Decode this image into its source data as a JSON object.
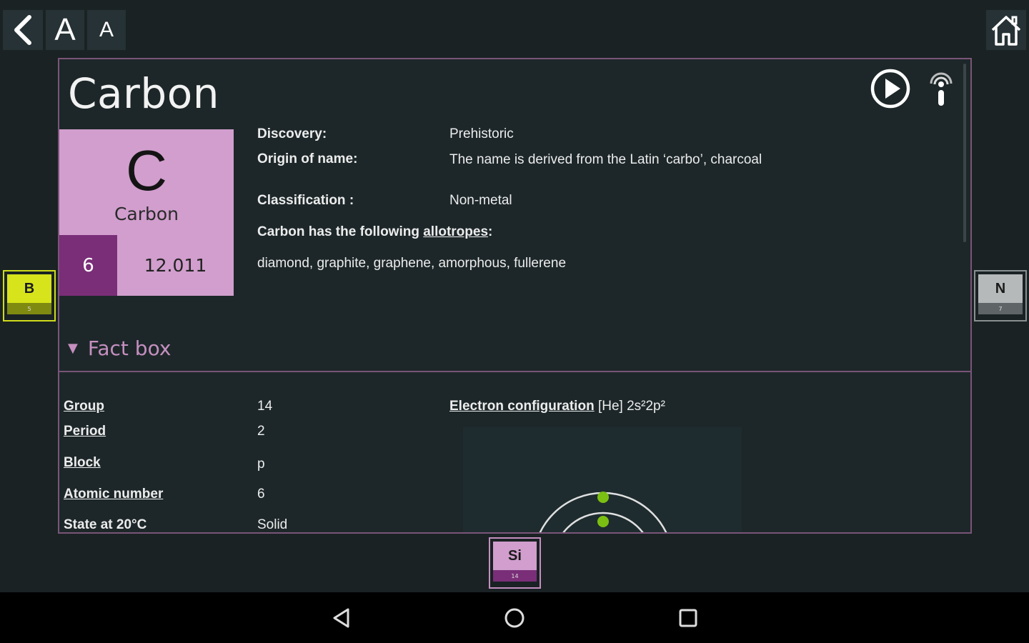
{
  "toolbar": {
    "font_larger_label": "A",
    "font_smaller_label": "A",
    "back_icon": "chevron-left-icon",
    "home_icon": "home-icon"
  },
  "element": {
    "name": "Carbon",
    "symbol": "C",
    "tile_name": "Carbon",
    "atomic_number": "6",
    "atomic_mass": "12.011",
    "color": "#d19ecd",
    "number_color": "#7a2e78"
  },
  "info": {
    "discovery_label": "Discovery:",
    "discovery_value": "Prehistoric",
    "origin_label": "Origin of name:",
    "origin_value": "The name is derived from the Latin ‘carbo’, charcoal",
    "classification_label": "Classification :",
    "classification_value": "Non-metal",
    "allotropes_prefix": "Carbon has the following ",
    "allotropes_link": "allotropes",
    "allotropes_suffix": ":",
    "allotropes_value": "diamond, graphite, graphene, amorphous, fullerene"
  },
  "factbox": {
    "toggle_label": "Fact box",
    "group_label": "Group",
    "group_value": "14",
    "period_label": "Period",
    "period_value": "2",
    "block_label": "Block",
    "block_value": "p",
    "atomic_number_label": "Atomic number",
    "atomic_number_value": "6",
    "state_label": "State at 20°C",
    "state_value": "Solid",
    "electron_config_label": "Electron configuration",
    "electron_config_value": "[He] 2s²2p²"
  },
  "neighbors": {
    "left": {
      "symbol": "B",
      "number": "5"
    },
    "right": {
      "symbol": "N",
      "number": "7"
    },
    "below": {
      "symbol": "Si",
      "number": "14"
    }
  },
  "navbar": {
    "back_icon": "nav-back-icon",
    "home_icon": "nav-home-icon",
    "recents_icon": "nav-recents-icon"
  }
}
